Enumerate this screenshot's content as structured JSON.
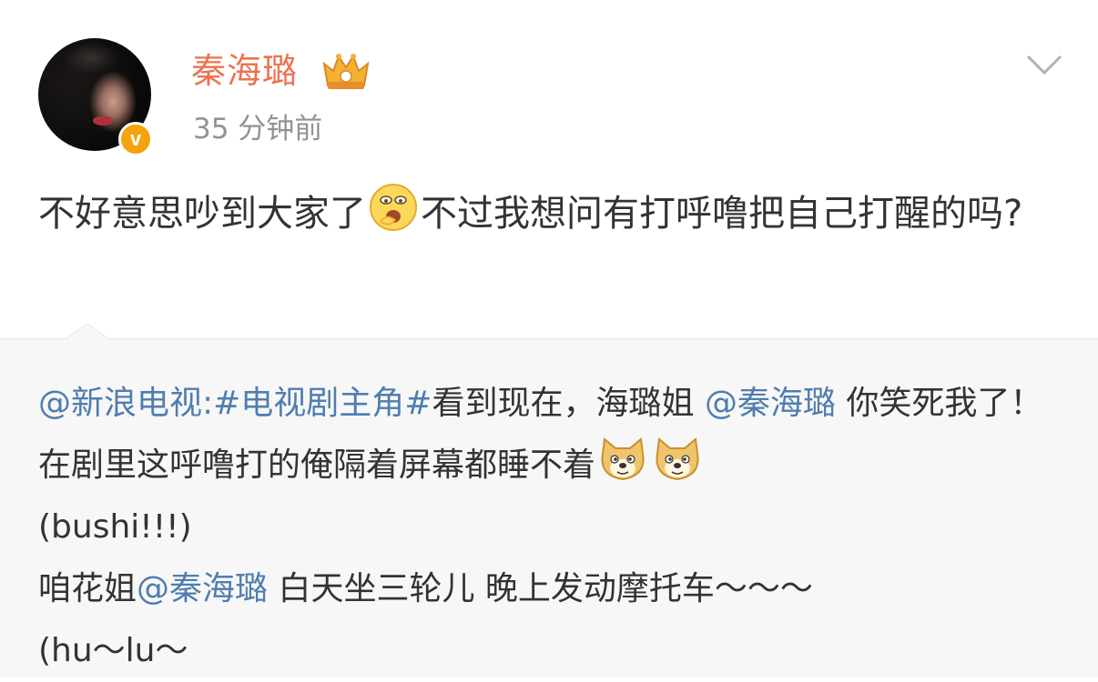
{
  "post": {
    "author": "秦海璐",
    "time": "35 分钟前",
    "text_part1": "不好意思吵到大家了",
    "text_part2": "不过我想问有打呼噜把自己打醒的吗?"
  },
  "repost": {
    "mention_source": "@新浪电视:",
    "hashtag": "#电视剧主角#",
    "text1": "看到现在，海璐姐",
    "mention1": "@秦海璐",
    "text2": " 你笑死我了！ 在剧里这呼噜打的俺隔着屏幕都睡不着",
    "text3": "(bushi!!!)",
    "line2_prefix": "咱花姐",
    "mention2": "@秦海璐",
    "text4": " 白天坐三轮儿 晚上发动摩托车～～～",
    "text5": "(hu～lu～"
  },
  "icons": {
    "avatar": "user-avatar",
    "verified": "verified-v-badge",
    "member": "crown-member-icon",
    "menu": "chevron-down-icon",
    "emoji1": "yawn-emoji",
    "emoji2": "doge-emoji"
  },
  "colors": {
    "username": "#eb7350",
    "link": "#507daf",
    "repost_bg": "#f7f7f7",
    "verified": "#f5a20d"
  },
  "verified_badge_letter": "v"
}
